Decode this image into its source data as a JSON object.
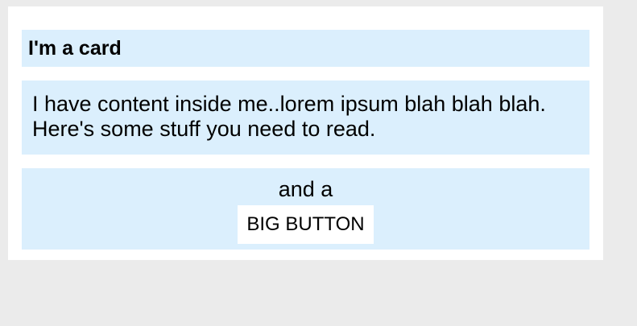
{
  "card": {
    "title": "I'm a card",
    "body_text": "I have content inside me..lorem ipsum blah blah blah. Here's some stuff you need to read.",
    "footer_text": "and a",
    "button_label": "BIG BUTTON"
  },
  "colors": {
    "page_background": "#ebebeb",
    "card_background": "#ffffff",
    "section_background": "#dbeffd",
    "text": "#000000"
  }
}
